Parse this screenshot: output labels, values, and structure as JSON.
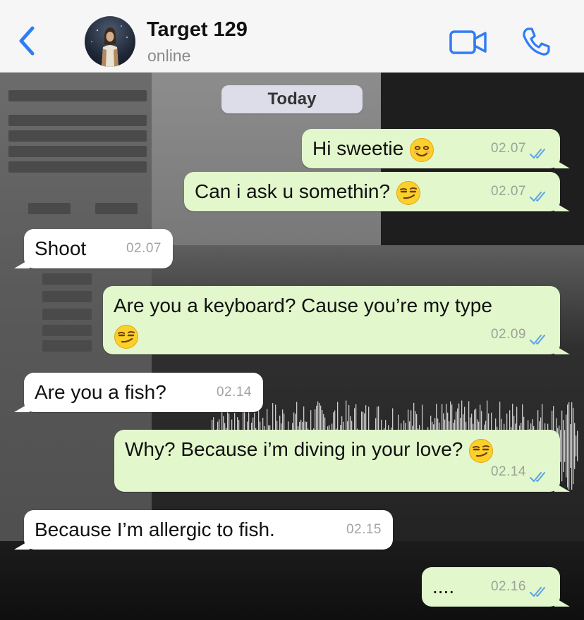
{
  "header": {
    "contact_name": "Target 129",
    "status": "online"
  },
  "icons": {
    "back": "chevron-left-icon",
    "video": "video-camera-icon",
    "call": "phone-icon",
    "read_receipt": "double-check-icon",
    "smile_emoji": "smiling-face-emoji",
    "smirk_emoji": "smirking-face-emoji"
  },
  "colors": {
    "accent": "#2f7cf6",
    "outgoing_bubble": "#e2f7cb",
    "incoming_bubble": "#ffffff",
    "date_pill": "#dcdde8",
    "read_tick": "#5aa3e8"
  },
  "date_separator": "Today",
  "messages": [
    {
      "direction": "out",
      "text": "Hi sweetie",
      "emoji": "smile",
      "time": "02.07",
      "read": true
    },
    {
      "direction": "out",
      "text": "Can i ask u somethin?",
      "emoji": "smirk",
      "time": "02.07",
      "read": true
    },
    {
      "direction": "in",
      "text": "Shoot",
      "time": "02.07"
    },
    {
      "direction": "out",
      "text": "Are you a keyboard? Cause you’re my type",
      "emoji": "smirk",
      "time": "02.09",
      "read": true
    },
    {
      "direction": "in",
      "text": "Are you a fish?",
      "time": "02.14"
    },
    {
      "direction": "out",
      "text": "Why? Because i’m diving in your love?",
      "emoji": "smirk",
      "time": "02.14",
      "read": true
    },
    {
      "direction": "in",
      "text": "Because I’m allergic to fish.",
      "time": "02.15"
    },
    {
      "direction": "out",
      "text": "....",
      "time": "02.16",
      "read": true
    }
  ]
}
